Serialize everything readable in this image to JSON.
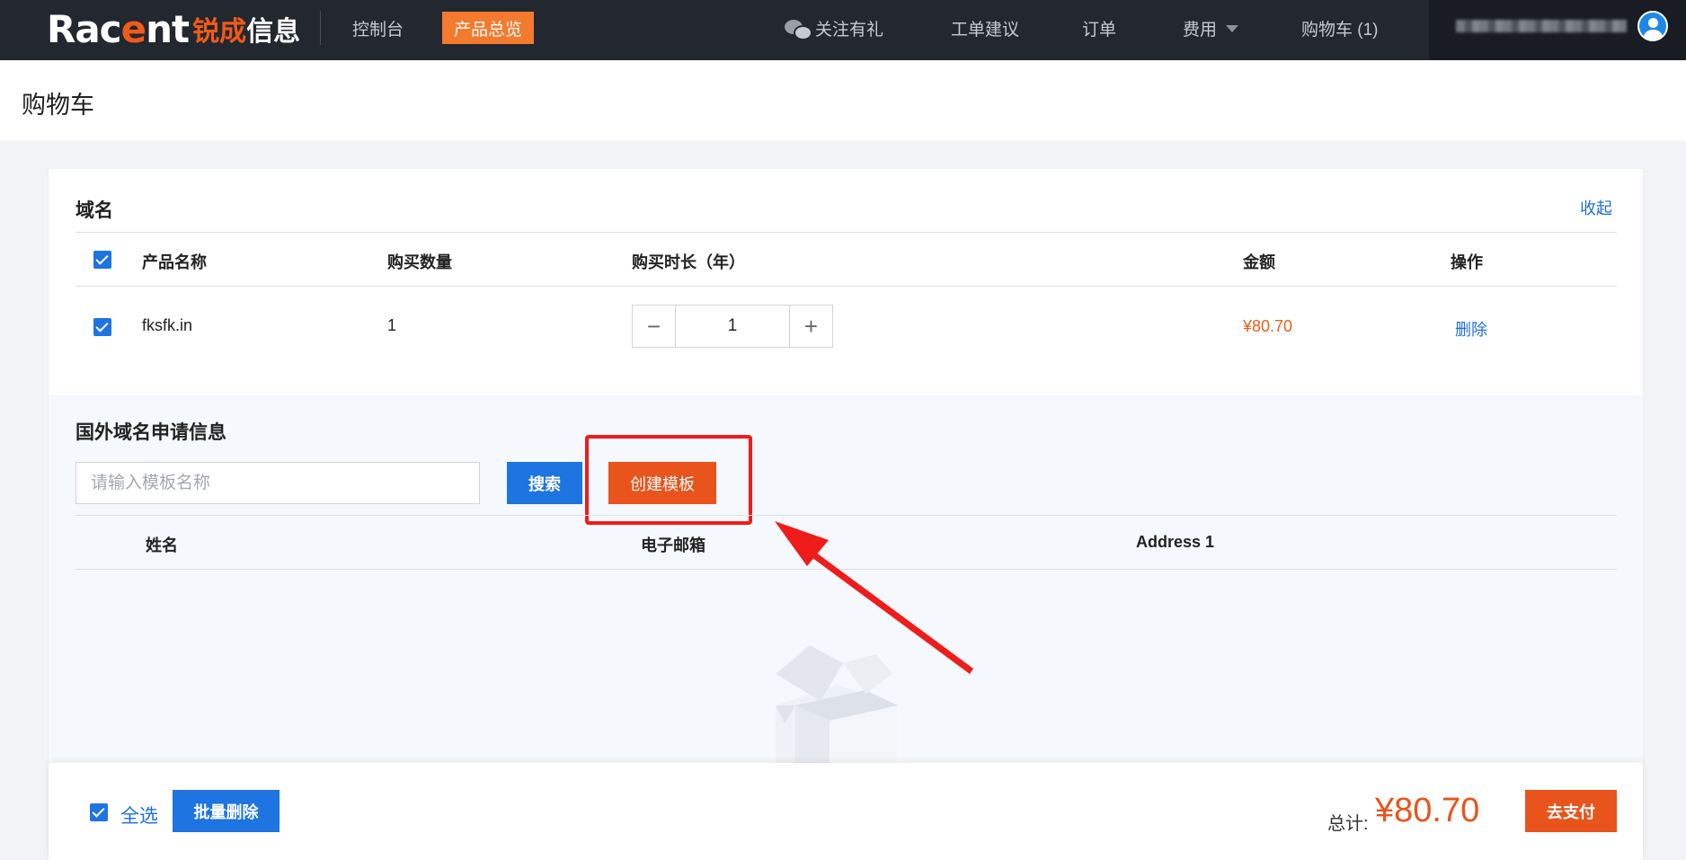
{
  "nav": {
    "logo_main_pre": "Rac",
    "logo_main_e": "e",
    "logo_main_post": "nt",
    "logo_sub_a": "锐成",
    "logo_sub_b": "信息",
    "console": "控制台",
    "product_overview": "产品总览",
    "follow_gift": "关注有礼",
    "ticket": "工单建议",
    "orders": "订单",
    "fees": "费用",
    "cart": "购物车 (1)"
  },
  "page": {
    "title": "购物车"
  },
  "domain_section": {
    "title": "域名",
    "collapse": "收起",
    "columns": {
      "product_name": "产品名称",
      "quantity": "购买数量",
      "duration": "购买时长（年）",
      "amount": "金额",
      "action": "操作"
    },
    "row": {
      "product": "fksfk.in",
      "quantity": "1",
      "duration": "1",
      "amount": "¥80.70",
      "delete": "删除"
    }
  },
  "registrant_section": {
    "title": "国外域名申请信息",
    "search_placeholder": "请输入模板名称",
    "search_button": "搜索",
    "create_button": "创建模板",
    "columns": {
      "name": "姓名",
      "email": "电子邮箱",
      "address": "Address 1"
    }
  },
  "footer": {
    "select_all": "全选",
    "batch_delete": "批量删除",
    "total_label": "总计:",
    "total_value": "¥80.70",
    "pay": "去支付"
  },
  "colors": {
    "accent_blue": "#1e74e0",
    "accent_orange": "#e8541c",
    "annotation_red": "#ef1c1c"
  }
}
